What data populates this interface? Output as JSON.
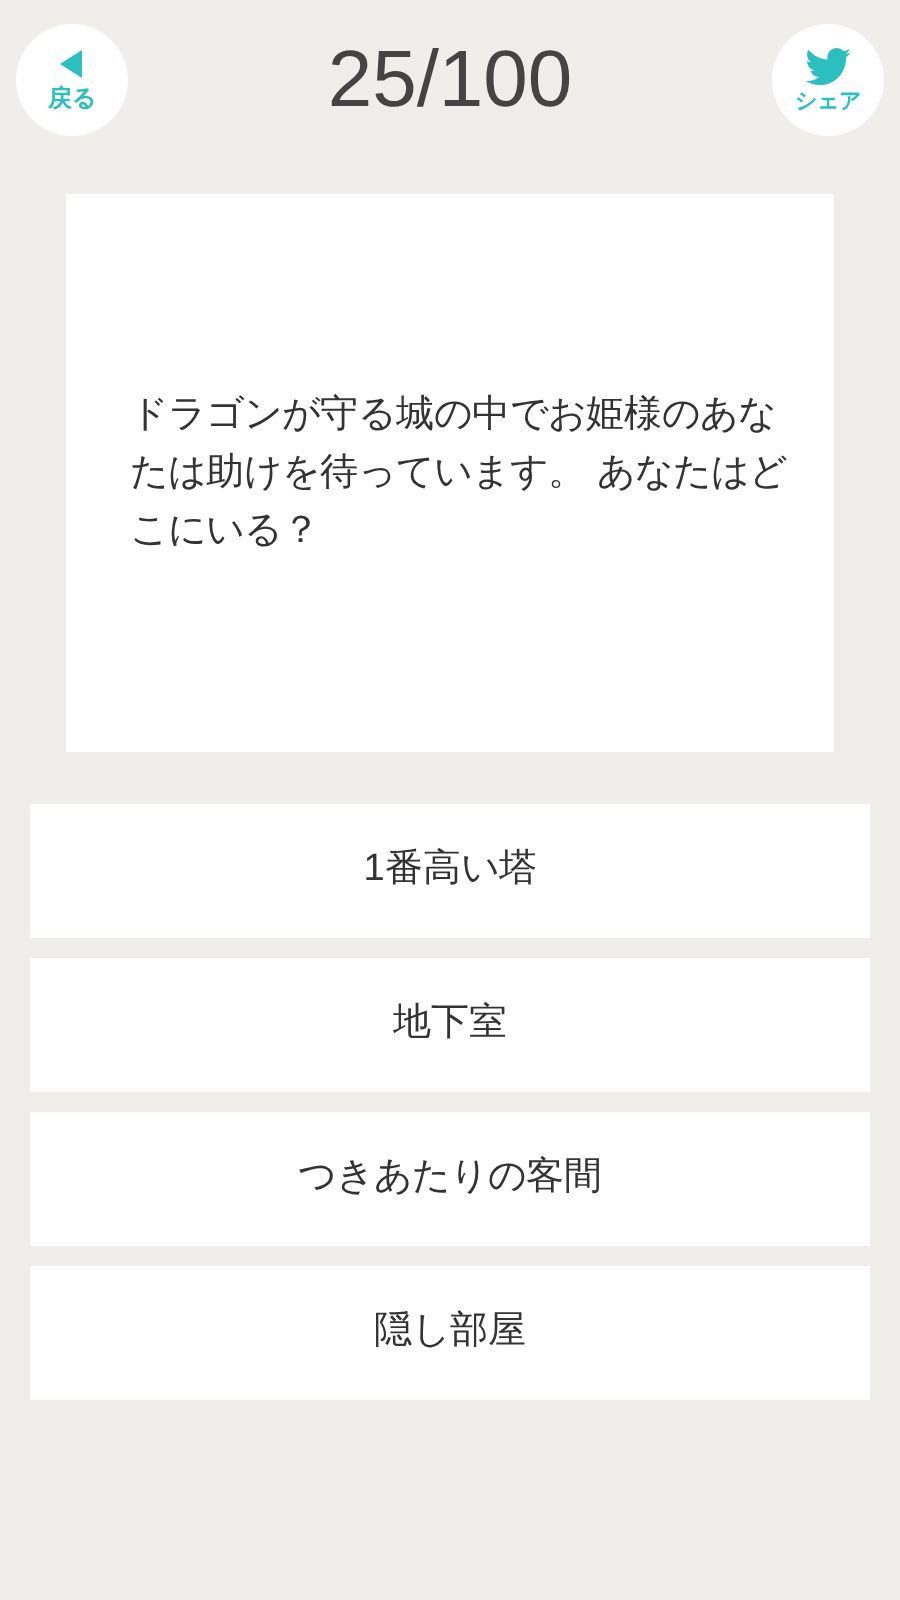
{
  "header": {
    "back_label": "戻る",
    "progress": "25/100",
    "share_label": "シェア"
  },
  "question": "ドラゴンが守る城の中でお姫様のあなたは助けを待っています。 あなたはどこにいる？",
  "answers": [
    {
      "label": "1番高い塔"
    },
    {
      "label": "地下室"
    },
    {
      "label": "つきあたりの客間"
    },
    {
      "label": "隠し部屋"
    }
  ]
}
